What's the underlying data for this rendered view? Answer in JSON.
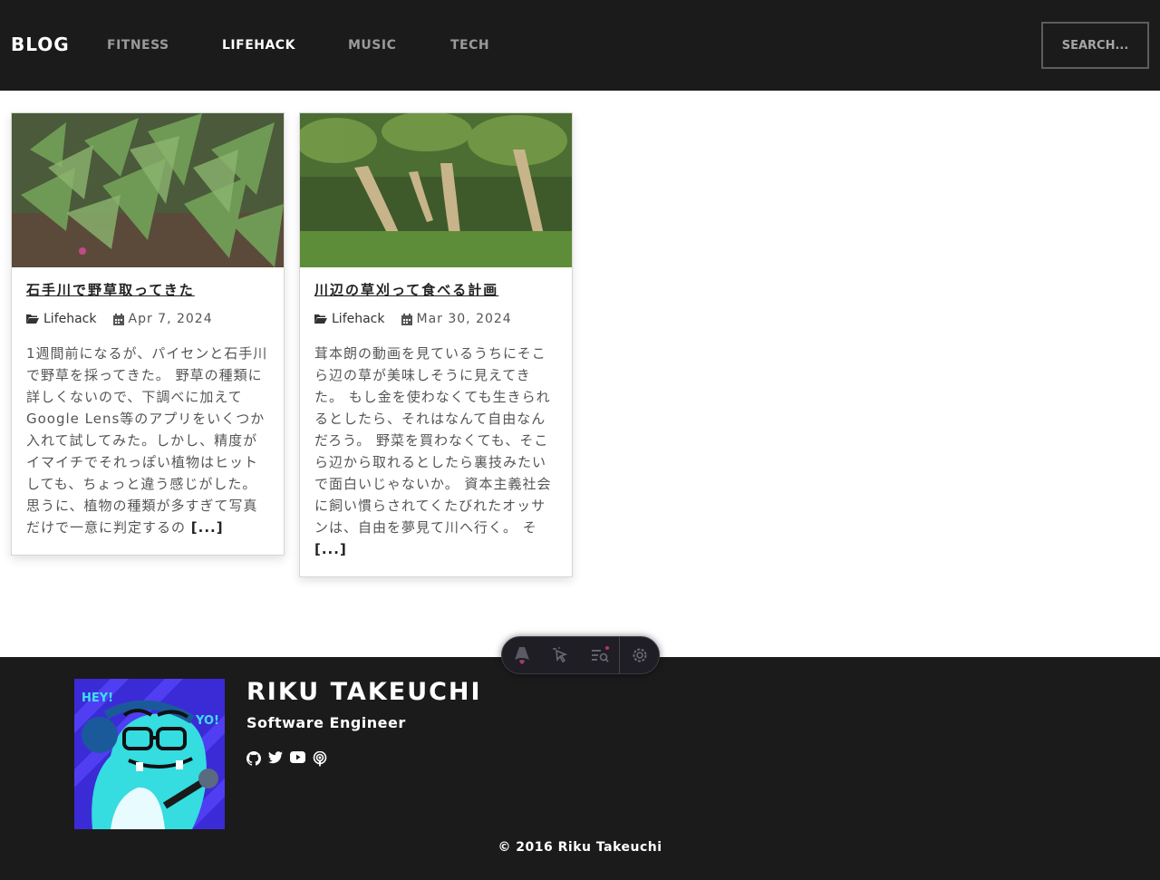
{
  "header": {
    "brand": "BLOG",
    "nav": [
      {
        "label": "FITNESS",
        "active": false
      },
      {
        "label": "LIFEHACK",
        "active": true
      },
      {
        "label": "MUSIC",
        "active": false
      },
      {
        "label": "TECH",
        "active": false
      }
    ],
    "search_placeholder": "SEARCH..."
  },
  "posts": [
    {
      "title": "石手川で野草取ってきた",
      "category": "Lifehack",
      "date": "Apr 7, 2024",
      "excerpt": "1週間前になるが、パイセンと石手川で野草を採ってきた。 野草の種類に詳しくないので、下調べに加えてGoogle Lens等のアプリをいくつか入れて試してみた。しかし、精度がイマイチでそれっぽい植物はヒットしても、ちょっと違う感じがした。 思うに、植物の種類が多すぎて写真だけで一意に判定するの",
      "more": "[...]"
    },
    {
      "title": "川辺の草刈って食べる計画",
      "category": "Lifehack",
      "date": "Mar 30, 2024",
      "excerpt": "茸本朗の動画を見ているうちにそこら辺の草が美味しそうに見えてきた。 もし金を使わなくても生きられるとしたら、それはなんて自由なんだろう。 野菜を買わなくても、そこら辺から取れるとしたら裏技みたいで面白いじゃないか。 資本主義社会に飼い慣らされてくたびれたオッサンは、自由を夢見て川へ行く。 そ",
      "more": "[...]"
    }
  ],
  "toolbar": {
    "icons": [
      "astro-logo-icon",
      "cursor-inspect-icon",
      "audit-list-icon",
      "settings-gear-icon"
    ]
  },
  "footer": {
    "avatar_text_left": "HEY!",
    "avatar_text_right": "YO!",
    "name": "RIKU TAKEUCHI",
    "role": "Software Engineer",
    "socials": [
      "github-icon",
      "twitter-icon",
      "youtube-icon",
      "podcast-icon"
    ],
    "copyright": "© 2016 Riku Takeuchi"
  },
  "colors": {
    "header_bg": "#1b1b1b",
    "footer_bg": "#1b1b1b",
    "nav_active": "#ffffff",
    "nav_inactive": "#9a9a9a"
  }
}
